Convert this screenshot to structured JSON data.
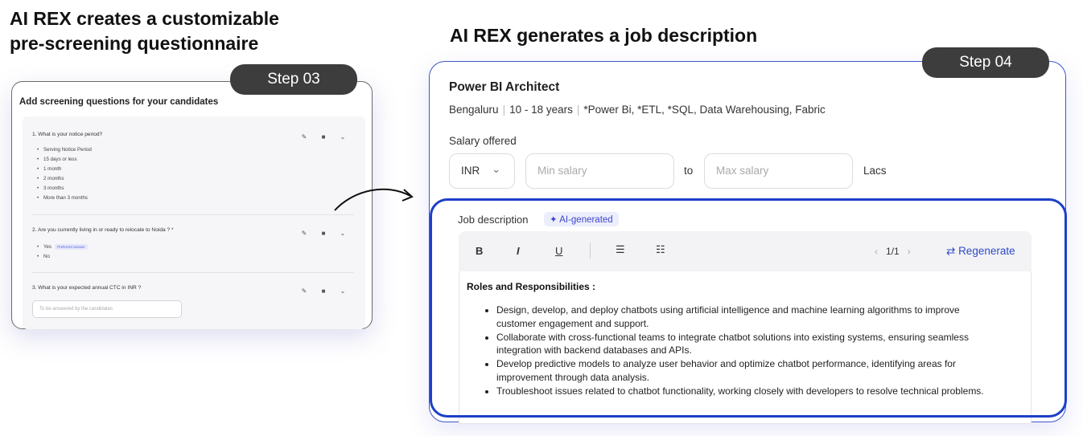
{
  "headings": {
    "left_line1": "AI REX creates a customizable",
    "left_line2": "pre-screening  questionnaire",
    "right": "AI REX generates  a job description"
  },
  "step03": {
    "badge": "Step 03",
    "title": "Add screening questions for your candidates",
    "questions": [
      {
        "text": "1. What is your notice period?",
        "options": [
          "Serving Notice Period",
          "15 days or less",
          "1 month",
          "2 months",
          "3 months",
          "More than 3 months"
        ]
      },
      {
        "text": "2. Are you currently living in or ready to relocate to Noida ? *",
        "options": [
          "Yes",
          "No"
        ],
        "preferred_badge": "Preferred answer"
      },
      {
        "text": "3. What is your expected annual CTC in INR ?",
        "input_placeholder": "To be answered by the candidates"
      }
    ]
  },
  "step04": {
    "badge": "Step 04",
    "job_title": "Power BI Architect",
    "location": "Bengaluru",
    "experience": "10 - 18 years",
    "skills": "*Power Bi,  *ETL,  *SQL, Data Warehousing, Fabric",
    "salary_label": "Salary offered",
    "currency": "INR",
    "min_placeholder": "Min salary",
    "to_label": "to",
    "max_placeholder": "Max salary",
    "unit": "Lacs",
    "jd_label": "Job description",
    "ai_badge": "AI-generated",
    "toolbar": {
      "bold": "B",
      "italic": "I",
      "underline": "U",
      "pager": "1/1",
      "regenerate": "Regenerate"
    },
    "roles_heading": "Roles and Responsibilities :",
    "responsibilities": [
      "Design, develop, and deploy chatbots using artificial intelligence and machine learning algorithms to improve customer engagement and support.",
      "Collaborate with cross-functional teams to integrate chatbot solutions into existing systems, ensuring seamless integration with backend databases and APIs.",
      "Develop predictive models to analyze user behavior and optimize chatbot performance, identifying areas for improvement through data analysis.",
      "Troubleshoot issues related to chatbot functionality, working closely with developers to resolve technical problems."
    ]
  }
}
